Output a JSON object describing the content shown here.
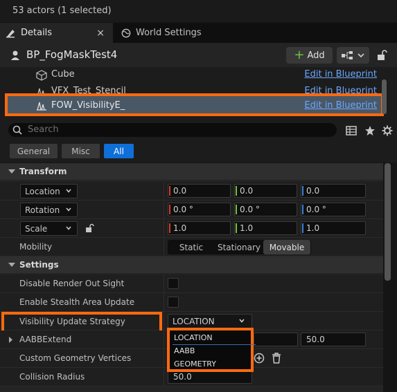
{
  "top_bar": {
    "actor_count": "53 actors (1 selected)"
  },
  "tabs": [
    {
      "label": "Details",
      "close": "×",
      "icon": "details-icon"
    },
    {
      "label": "World Settings",
      "icon": "globe-icon"
    }
  ],
  "header": {
    "title": "BP_FogMaskTest4",
    "add_label": "Add"
  },
  "components": [
    {
      "name": "Cube",
      "edit": "Edit in Blueprint",
      "icon": "cube-icon"
    },
    {
      "name": "VFX_Test_Stencil",
      "edit": "Edit in Blueprint",
      "icon": "niagara-icon"
    },
    {
      "name": "FOW_VisibilityE_",
      "edit": "Edit in Blueprint",
      "icon": "niagara-icon"
    }
  ],
  "search": {
    "placeholder": "Search"
  },
  "filters": [
    "General",
    "Misc",
    "All"
  ],
  "transform": {
    "category": "Transform",
    "location": {
      "label": "Location",
      "x": "0.0",
      "y": "0.0",
      "z": "0.0"
    },
    "rotation": {
      "label": "Rotation",
      "x": "0.0 °",
      "y": "0.0 °",
      "z": "0.0 °"
    },
    "scale": {
      "label": "Scale",
      "x": "1.0",
      "y": "1.0",
      "z": "1.0"
    },
    "mobility": {
      "label": "Mobility",
      "options": [
        "Static",
        "Stationary",
        "Movable"
      ],
      "selected": "Movable"
    }
  },
  "settings": {
    "category": "Settings",
    "disable_render": "Disable Render Out Sight",
    "enable_stealth": "Enable Stealth Area Update",
    "visibility_strategy": {
      "label": "Visibility Update Strategy",
      "value": "LOCATION"
    },
    "aabb_extend": {
      "label": "AABBExtend",
      "value": "50.0"
    },
    "custom_geometry": "Custom Geometry Vertices",
    "collision_radius": {
      "label": "Collision Radius",
      "value": "50.0"
    }
  },
  "dropdown_options": [
    "LOCATION",
    "AABB",
    "GEOMETRY"
  ],
  "colors": {
    "accent": "#0f6fd8",
    "highlight": "#ff6a0f",
    "link": "#6aa7ff",
    "x_axis": "#d43a2a",
    "y_axis": "#6ec33c",
    "z_axis": "#3a7fd4"
  }
}
